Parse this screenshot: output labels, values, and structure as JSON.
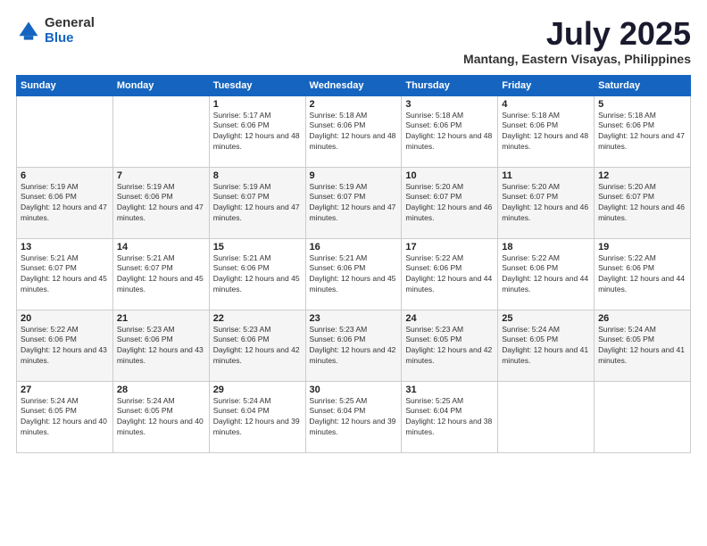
{
  "logo": {
    "general": "General",
    "blue": "Blue"
  },
  "header": {
    "month": "July 2025",
    "location": "Mantang, Eastern Visayas, Philippines"
  },
  "weekdays": [
    "Sunday",
    "Monday",
    "Tuesday",
    "Wednesday",
    "Thursday",
    "Friday",
    "Saturday"
  ],
  "weeks": [
    [
      {
        "day": "",
        "sunrise": "",
        "sunset": "",
        "daylight": ""
      },
      {
        "day": "",
        "sunrise": "",
        "sunset": "",
        "daylight": ""
      },
      {
        "day": "1",
        "sunrise": "Sunrise: 5:17 AM",
        "sunset": "Sunset: 6:06 PM",
        "daylight": "Daylight: 12 hours and 48 minutes."
      },
      {
        "day": "2",
        "sunrise": "Sunrise: 5:18 AM",
        "sunset": "Sunset: 6:06 PM",
        "daylight": "Daylight: 12 hours and 48 minutes."
      },
      {
        "day": "3",
        "sunrise": "Sunrise: 5:18 AM",
        "sunset": "Sunset: 6:06 PM",
        "daylight": "Daylight: 12 hours and 48 minutes."
      },
      {
        "day": "4",
        "sunrise": "Sunrise: 5:18 AM",
        "sunset": "Sunset: 6:06 PM",
        "daylight": "Daylight: 12 hours and 48 minutes."
      },
      {
        "day": "5",
        "sunrise": "Sunrise: 5:18 AM",
        "sunset": "Sunset: 6:06 PM",
        "daylight": "Daylight: 12 hours and 47 minutes."
      }
    ],
    [
      {
        "day": "6",
        "sunrise": "Sunrise: 5:19 AM",
        "sunset": "Sunset: 6:06 PM",
        "daylight": "Daylight: 12 hours and 47 minutes."
      },
      {
        "day": "7",
        "sunrise": "Sunrise: 5:19 AM",
        "sunset": "Sunset: 6:06 PM",
        "daylight": "Daylight: 12 hours and 47 minutes."
      },
      {
        "day": "8",
        "sunrise": "Sunrise: 5:19 AM",
        "sunset": "Sunset: 6:07 PM",
        "daylight": "Daylight: 12 hours and 47 minutes."
      },
      {
        "day": "9",
        "sunrise": "Sunrise: 5:19 AM",
        "sunset": "Sunset: 6:07 PM",
        "daylight": "Daylight: 12 hours and 47 minutes."
      },
      {
        "day": "10",
        "sunrise": "Sunrise: 5:20 AM",
        "sunset": "Sunset: 6:07 PM",
        "daylight": "Daylight: 12 hours and 46 minutes."
      },
      {
        "day": "11",
        "sunrise": "Sunrise: 5:20 AM",
        "sunset": "Sunset: 6:07 PM",
        "daylight": "Daylight: 12 hours and 46 minutes."
      },
      {
        "day": "12",
        "sunrise": "Sunrise: 5:20 AM",
        "sunset": "Sunset: 6:07 PM",
        "daylight": "Daylight: 12 hours and 46 minutes."
      }
    ],
    [
      {
        "day": "13",
        "sunrise": "Sunrise: 5:21 AM",
        "sunset": "Sunset: 6:07 PM",
        "daylight": "Daylight: 12 hours and 45 minutes."
      },
      {
        "day": "14",
        "sunrise": "Sunrise: 5:21 AM",
        "sunset": "Sunset: 6:07 PM",
        "daylight": "Daylight: 12 hours and 45 minutes."
      },
      {
        "day": "15",
        "sunrise": "Sunrise: 5:21 AM",
        "sunset": "Sunset: 6:06 PM",
        "daylight": "Daylight: 12 hours and 45 minutes."
      },
      {
        "day": "16",
        "sunrise": "Sunrise: 5:21 AM",
        "sunset": "Sunset: 6:06 PM",
        "daylight": "Daylight: 12 hours and 45 minutes."
      },
      {
        "day": "17",
        "sunrise": "Sunrise: 5:22 AM",
        "sunset": "Sunset: 6:06 PM",
        "daylight": "Daylight: 12 hours and 44 minutes."
      },
      {
        "day": "18",
        "sunrise": "Sunrise: 5:22 AM",
        "sunset": "Sunset: 6:06 PM",
        "daylight": "Daylight: 12 hours and 44 minutes."
      },
      {
        "day": "19",
        "sunrise": "Sunrise: 5:22 AM",
        "sunset": "Sunset: 6:06 PM",
        "daylight": "Daylight: 12 hours and 44 minutes."
      }
    ],
    [
      {
        "day": "20",
        "sunrise": "Sunrise: 5:22 AM",
        "sunset": "Sunset: 6:06 PM",
        "daylight": "Daylight: 12 hours and 43 minutes."
      },
      {
        "day": "21",
        "sunrise": "Sunrise: 5:23 AM",
        "sunset": "Sunset: 6:06 PM",
        "daylight": "Daylight: 12 hours and 43 minutes."
      },
      {
        "day": "22",
        "sunrise": "Sunrise: 5:23 AM",
        "sunset": "Sunset: 6:06 PM",
        "daylight": "Daylight: 12 hours and 42 minutes."
      },
      {
        "day": "23",
        "sunrise": "Sunrise: 5:23 AM",
        "sunset": "Sunset: 6:06 PM",
        "daylight": "Daylight: 12 hours and 42 minutes."
      },
      {
        "day": "24",
        "sunrise": "Sunrise: 5:23 AM",
        "sunset": "Sunset: 6:05 PM",
        "daylight": "Daylight: 12 hours and 42 minutes."
      },
      {
        "day": "25",
        "sunrise": "Sunrise: 5:24 AM",
        "sunset": "Sunset: 6:05 PM",
        "daylight": "Daylight: 12 hours and 41 minutes."
      },
      {
        "day": "26",
        "sunrise": "Sunrise: 5:24 AM",
        "sunset": "Sunset: 6:05 PM",
        "daylight": "Daylight: 12 hours and 41 minutes."
      }
    ],
    [
      {
        "day": "27",
        "sunrise": "Sunrise: 5:24 AM",
        "sunset": "Sunset: 6:05 PM",
        "daylight": "Daylight: 12 hours and 40 minutes."
      },
      {
        "day": "28",
        "sunrise": "Sunrise: 5:24 AM",
        "sunset": "Sunset: 6:05 PM",
        "daylight": "Daylight: 12 hours and 40 minutes."
      },
      {
        "day": "29",
        "sunrise": "Sunrise: 5:24 AM",
        "sunset": "Sunset: 6:04 PM",
        "daylight": "Daylight: 12 hours and 39 minutes."
      },
      {
        "day": "30",
        "sunrise": "Sunrise: 5:25 AM",
        "sunset": "Sunset: 6:04 PM",
        "daylight": "Daylight: 12 hours and 39 minutes."
      },
      {
        "day": "31",
        "sunrise": "Sunrise: 5:25 AM",
        "sunset": "Sunset: 6:04 PM",
        "daylight": "Daylight: 12 hours and 38 minutes."
      },
      {
        "day": "",
        "sunrise": "",
        "sunset": "",
        "daylight": ""
      },
      {
        "day": "",
        "sunrise": "",
        "sunset": "",
        "daylight": ""
      }
    ]
  ]
}
